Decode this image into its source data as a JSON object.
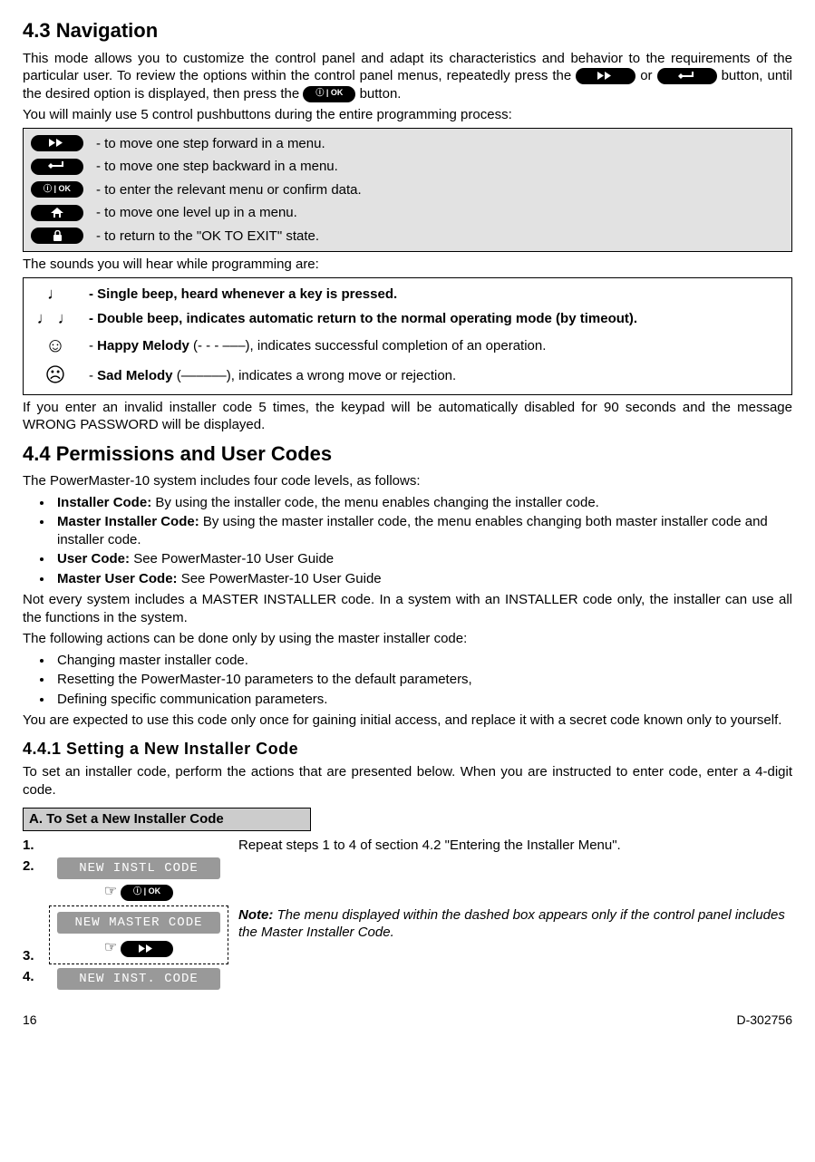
{
  "sec43": {
    "title": "4.3 Navigation",
    "p1a": "This mode allows you to customize the control panel and adapt its characteristics and behavior to the requirements of the particular user. To review the options within the control panel menus, repeatedly press the ",
    "p1b": " or ",
    "p1c": " button, until the desired option is displayed, then press the ",
    "p1d": " button.",
    "p2": "You will mainly use 5 control pushbuttons during the entire programming process:",
    "b1": "- to move one step forward in a menu.",
    "b2": "- to move one step backward in a menu.",
    "b3": "- to enter the relevant menu or confirm data.",
    "b4": "- to move one level up in a menu.",
    "b5": "- to return to the \"OK TO EXIT\" state.",
    "p3": "The sounds you will hear while programming are:",
    "s1": "- Single beep, heard whenever a key is pressed.",
    "s2": "- Double beep, indicates automatic return to the normal operating mode (by timeout).",
    "s3a": "- ",
    "s3b": "Happy Melody",
    "s3c": " (- - - –––), indicates successful completion of an operation.",
    "s4a": "- ",
    "s4b": "Sad Melody",
    "s4c": " (––––––), indicates a wrong move or rejection.",
    "p4": "If you enter an invalid installer code 5 times, the keypad will be automatically disabled for 90 seconds and the message WRONG PASSWORD will be displayed."
  },
  "sec44": {
    "title": "4.4 Permissions and User Codes",
    "p1": "The PowerMaster-10 system includes four code levels, as follows:",
    "li1a": "Installer Code:",
    "li1b": " By using the installer code, the menu enables changing the installer code.",
    "li2a": "Master Installer Code:",
    "li2b": " By using the master installer code, the menu enables changing both master installer code and installer code.",
    "li3a": "User Code:",
    "li3b": " See PowerMaster-10 User Guide",
    "li4a": "Master User Code:",
    "li4b": " See PowerMaster-10 User Guide",
    "p2": "Not every system includes a MASTER INSTALLER code. In a system with an INSTALLER code only, the installer can use all the functions in the system.",
    "p3": "The following actions can be done only by using the master installer code:",
    "mi1": "Changing master installer code.",
    "mi2": "Resetting the PowerMaster-10 parameters to the default parameters,",
    "mi3": "Defining specific communication parameters.",
    "p4": "You are expected to use this code only once for gaining initial access, and replace it with a secret code known only to yourself."
  },
  "sec441": {
    "title": "4.4.1 Setting a New Installer Code",
    "p1": "To set an installer code, perform the actions that are presented below. When you are instructed to enter code, enter a 4-digit code.",
    "boxTitle": "A. To Set a New Installer Code",
    "step1": "Repeat steps 1 to 4 of section 4.2 \"Entering the Installer Menu\".",
    "lcd1": "NEW INSTL CODE",
    "lcd2": "NEW MASTER CODE",
    "lcd3": "NEW INST. CODE",
    "noteA": "Note:",
    "noteB": " The menu displayed within the dashed box appears only if the control panel includes the Master Installer Code.",
    "n1": "1.",
    "n2": "2.",
    "n3": "3.",
    "n4": "4."
  },
  "iok": "ⓘ | OK",
  "footer": {
    "page": "16",
    "doc": "D-302756"
  }
}
